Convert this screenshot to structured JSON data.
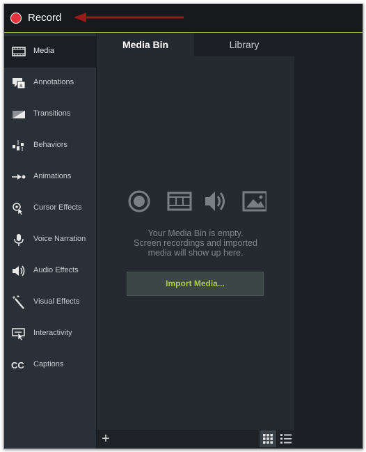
{
  "toolbar": {
    "record_label": "Record"
  },
  "colors": {
    "record": "#e5333f",
    "accent": "#a6cd3a",
    "annotation_arrow": "#9b1a1a"
  },
  "sidebar": {
    "items": [
      {
        "label": "Media",
        "icon": "film-strip-icon",
        "active": true
      },
      {
        "label": "Annotations",
        "icon": "annotation-icon"
      },
      {
        "label": "Transitions",
        "icon": "transition-icon"
      },
      {
        "label": "Behaviors",
        "icon": "behaviors-icon"
      },
      {
        "label": "Animations",
        "icon": "animation-icon"
      },
      {
        "label": "Cursor Effects",
        "icon": "cursor-effects-icon"
      },
      {
        "label": "Voice Narration",
        "icon": "microphone-icon"
      },
      {
        "label": "Audio Effects",
        "icon": "speaker-icon"
      },
      {
        "label": "Visual Effects",
        "icon": "magic-wand-icon"
      },
      {
        "label": "Interactivity",
        "icon": "interactivity-icon"
      },
      {
        "label": "Captions",
        "icon": "captions-icon"
      }
    ]
  },
  "panel": {
    "tabs": [
      {
        "label": "Media Bin",
        "active": true
      },
      {
        "label": "Library"
      }
    ],
    "empty_line1": "Your Media Bin is empty.",
    "empty_line2": "Screen recordings and imported",
    "empty_line3": "media will show up here.",
    "import_label": "Import Media...",
    "add_symbol": "+"
  }
}
